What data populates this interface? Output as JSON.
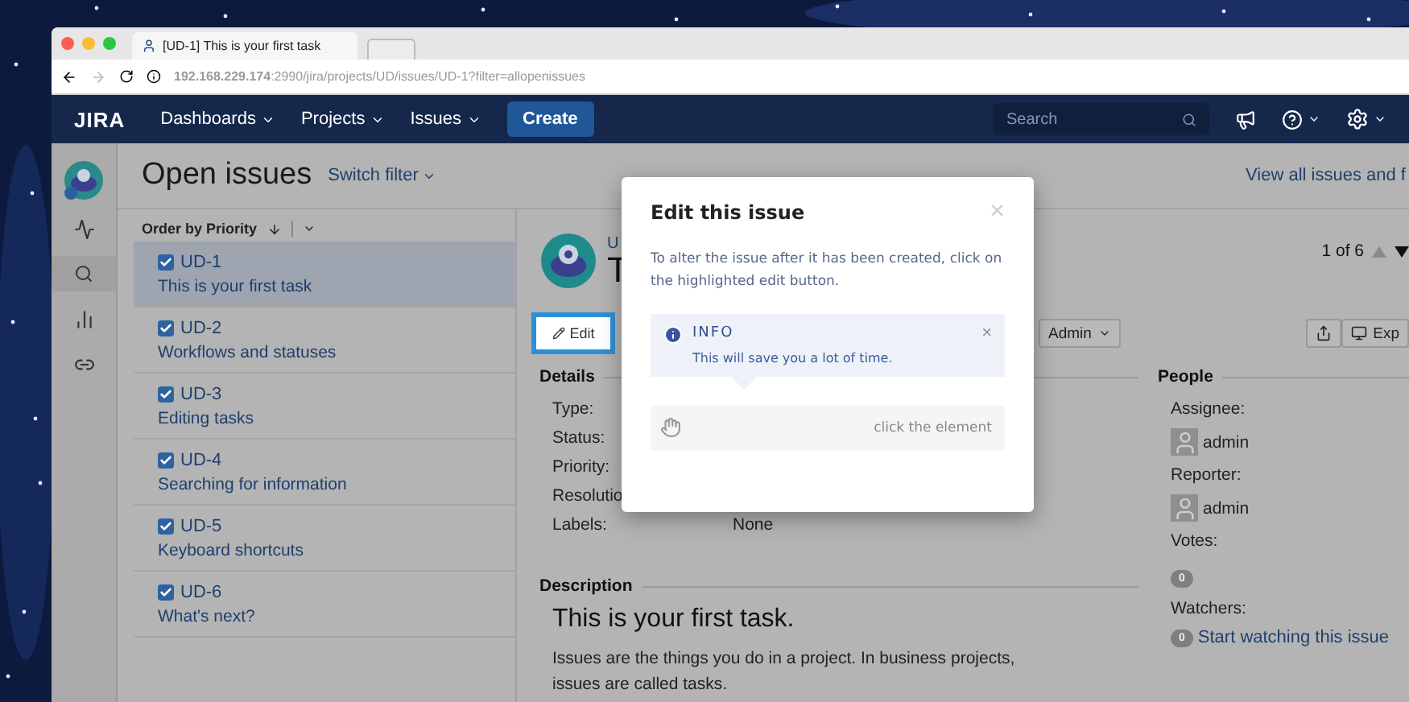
{
  "browser": {
    "tab_title": "[UD-1] This is your first task",
    "url": "**192.168.229.174**:2990/jira/projects/UD/issues/UD-1?filter=allopenissues"
  },
  "nav": {
    "logo": "JIRA",
    "menus": [
      "Dashboards",
      "Projects",
      "Issues"
    ],
    "create": "Create",
    "search": {
      "placeholder": "Search"
    }
  },
  "header": {
    "title": "Open issues",
    "switch_filter": "Switch filter",
    "view_all": "View all issues and f"
  },
  "list": {
    "order": "Order by Priority",
    "items": [
      {
        "key": "UD-1",
        "summary": "This is your first task",
        "checked": true,
        "selected": true
      },
      {
        "key": "UD-2",
        "summary": "Workflows and statuses",
        "checked": true,
        "selected": false
      },
      {
        "key": "UD-3",
        "summary": "Editing tasks",
        "checked": true,
        "selected": false
      },
      {
        "key": "UD-4",
        "summary": "Searching for information",
        "checked": true,
        "selected": false
      },
      {
        "key": "UD-5",
        "summary": "Keyboard shortcuts",
        "checked": true,
        "selected": false
      },
      {
        "key": "UD-6",
        "summary": "What's next?",
        "checked": true,
        "selected": false
      }
    ]
  },
  "issue": {
    "project_link": "U",
    "title": "T",
    "pager": "1 of 6",
    "edit": "Edit",
    "admin": "Admin",
    "export": "Exp",
    "details_heading": "Details",
    "fields": [
      {
        "label": "Type:"
      },
      {
        "label": "Status:"
      },
      {
        "label": "Priority:"
      },
      {
        "label": "Resolutio"
      },
      {
        "label": "Labels:",
        "value": "None"
      }
    ],
    "description_heading": "Description",
    "description_title": "This is your first task.",
    "description_text": "Issues are the things you do in a project. In business projects, issues are called tasks.",
    "people_heading": "People",
    "assignee_label": "Assignee:",
    "assignee": "admin",
    "reporter_label": "Reporter:",
    "reporter": "admin",
    "votes_label": "Votes:",
    "votes": "0",
    "watchers_label": "Watchers:",
    "watchers": "0",
    "watch_link": "Start watching this issue"
  },
  "dialog": {
    "title": "Edit this issue",
    "close": "×",
    "body": "To alter the issue after it has been created, click on the highlighted edit button.",
    "info": {
      "title": "INFO",
      "text": "This will save you a lot of time.",
      "close": "×"
    },
    "hint": "click the element"
  }
}
